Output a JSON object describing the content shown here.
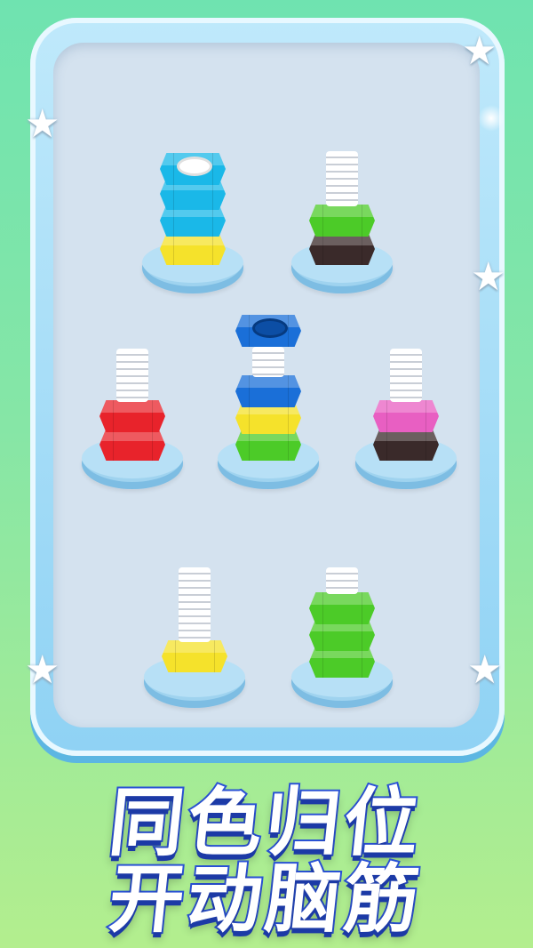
{
  "title": {
    "line1": "同色归位",
    "line2": "开动脑筋"
  },
  "colors": {
    "cyan": "#1ab8e8",
    "yellow": "#f5e22b",
    "green": "#4ccb28",
    "dark_brown": "#3a2a2a",
    "red": "#e8232b",
    "blue": "#1a6fd8",
    "pink": "#e85fc2",
    "board": "#d4e2ef",
    "frame": "#8fd2f4",
    "title_outline": "#2a52d6"
  },
  "pegs": [
    {
      "name": "peg-top-left",
      "nuts_bottom_to_top": [
        "yellow",
        "cyan",
        "cyan",
        "cyan"
      ]
    },
    {
      "name": "peg-top-right",
      "nuts_bottom_to_top": [
        "dark_brown",
        "green"
      ]
    },
    {
      "name": "peg-middle-left",
      "nuts_bottom_to_top": [
        "red",
        "red"
      ]
    },
    {
      "name": "peg-middle-center",
      "nuts_bottom_to_top": [
        "green",
        "yellow",
        "blue"
      ],
      "lifted_nut": "blue"
    },
    {
      "name": "peg-middle-right",
      "nuts_bottom_to_top": [
        "dark_brown",
        "pink"
      ]
    },
    {
      "name": "peg-bottom-left",
      "nuts_bottom_to_top": [
        "yellow"
      ]
    },
    {
      "name": "peg-bottom-right",
      "nuts_bottom_to_top": [
        "green",
        "green",
        "green"
      ]
    }
  ]
}
